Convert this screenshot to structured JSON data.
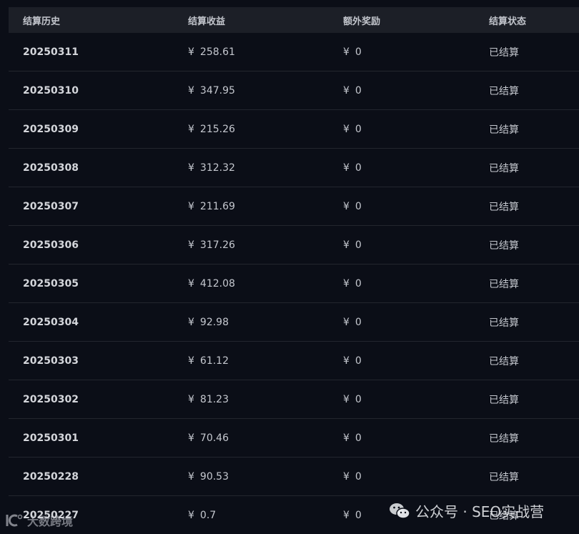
{
  "table": {
    "headers": {
      "date": "结算历史",
      "income": "结算收益",
      "bonus": "额外奖励",
      "status": "结算状态"
    },
    "currency": "¥",
    "rows": [
      {
        "date": "20250311",
        "income": "258.61",
        "bonus": "0",
        "status": "已结算"
      },
      {
        "date": "20250310",
        "income": "347.95",
        "bonus": "0",
        "status": "已结算"
      },
      {
        "date": "20250309",
        "income": "215.26",
        "bonus": "0",
        "status": "已结算"
      },
      {
        "date": "20250308",
        "income": "312.32",
        "bonus": "0",
        "status": "已结算"
      },
      {
        "date": "20250307",
        "income": "211.69",
        "bonus": "0",
        "status": "已结算"
      },
      {
        "date": "20250306",
        "income": "317.26",
        "bonus": "0",
        "status": "已结算"
      },
      {
        "date": "20250305",
        "income": "412.08",
        "bonus": "0",
        "status": "已结算"
      },
      {
        "date": "20250304",
        "income": "92.98",
        "bonus": "0",
        "status": "已结算"
      },
      {
        "date": "20250303",
        "income": "61.12",
        "bonus": "0",
        "status": "已结算"
      },
      {
        "date": "20250302",
        "income": "81.23",
        "bonus": "0",
        "status": "已结算"
      },
      {
        "date": "20250301",
        "income": "70.46",
        "bonus": "0",
        "status": "已结算"
      },
      {
        "date": "20250228",
        "income": "90.53",
        "bonus": "0",
        "status": "已结算"
      },
      {
        "date": "20250227",
        "income": "0.7",
        "bonus": "0",
        "status": "已结算"
      }
    ]
  },
  "watermarks": {
    "left_text": "大数跨境",
    "right_text": "公众号 · SEO实战营"
  },
  "colors": {
    "background": "#0b0e17",
    "header_background": "#1c1f27",
    "row_divider": "#23262e",
    "text": "#c5c8cf"
  }
}
